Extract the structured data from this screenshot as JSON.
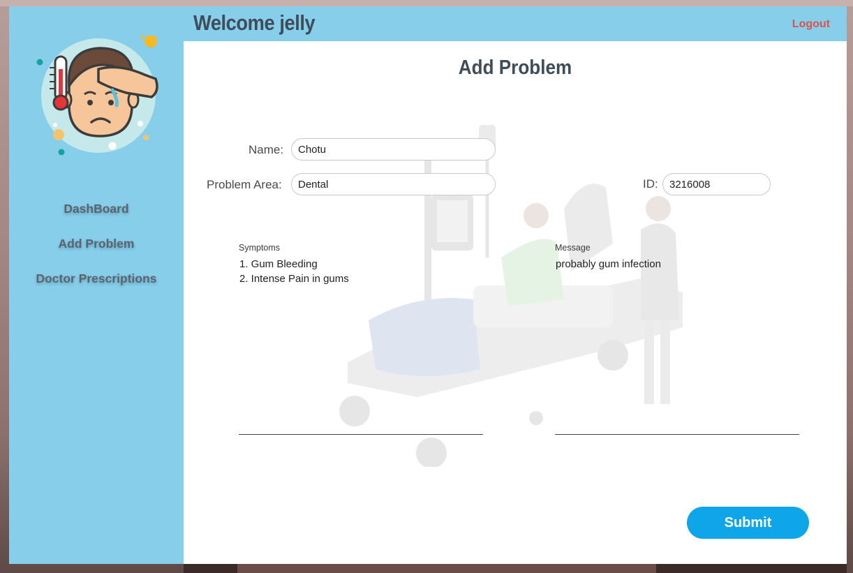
{
  "header": {
    "welcome": "Welcome jelly",
    "logout_label": "Logout"
  },
  "sidebar": {
    "avatar_icon": "sick-person-fever-icon",
    "items": [
      {
        "label": "DashBoard"
      },
      {
        "label": "Add Problem"
      },
      {
        "label": "Doctor Prescriptions"
      }
    ]
  },
  "main": {
    "title": "Add Problem",
    "name_label": "Name:",
    "name_value": "Chotu",
    "problem_area_label": "Problem Area:",
    "problem_area_value": "Dental",
    "id_label": "ID:",
    "id_value": "3216008",
    "symptoms_label": "Symptoms",
    "symptoms_value": "1. Gum Bleeding\n2. Intense Pain in gums",
    "message_label": "Message",
    "message_value": "probably gum infection",
    "submit_label": "Submit",
    "background_illustration": "hospital-bed-patient-nurse-illustration"
  },
  "colors": {
    "sidebar_bg": "#87ceeb",
    "logout": "#d9534f",
    "submit_bg": "#0ea5e9",
    "title_text": "#3e4d59"
  }
}
